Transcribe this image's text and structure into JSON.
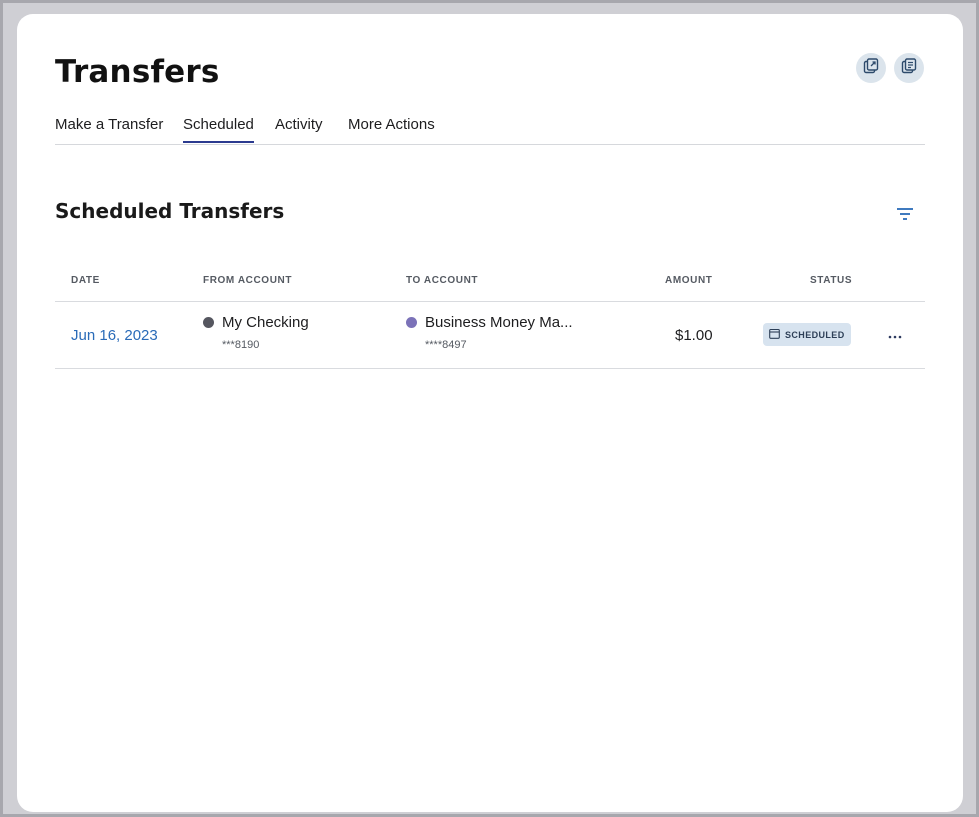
{
  "page": {
    "title": "Transfers"
  },
  "header_actions": [
    {
      "icon": "export-icon"
    },
    {
      "icon": "print-icon"
    }
  ],
  "tabs": [
    {
      "label": "Make a Transfer",
      "active": false
    },
    {
      "label": "Scheduled",
      "active": true
    },
    {
      "label": "Activity",
      "active": false
    },
    {
      "label": "More Actions",
      "active": false
    }
  ],
  "section": {
    "title": "Scheduled Transfers",
    "filter_icon": "filter-icon"
  },
  "table": {
    "columns": [
      "DATE",
      "FROM ACCOUNT",
      "TO ACCOUNT",
      "AMOUNT",
      "STATUS"
    ],
    "rows": [
      {
        "date": "Jun 16, 2023",
        "from_name": "My Checking",
        "from_number": "***8190",
        "from_color": "#55565f",
        "to_name": "Business Money Ma...",
        "to_number": "****8497",
        "to_color": "#7b72b8",
        "amount": "$1.00",
        "status": "SCHEDULED"
      }
    ]
  },
  "colors": {
    "accent": "#2b3a8f",
    "link": "#2a6bb8",
    "badge_bg": "#d7e3ef"
  }
}
